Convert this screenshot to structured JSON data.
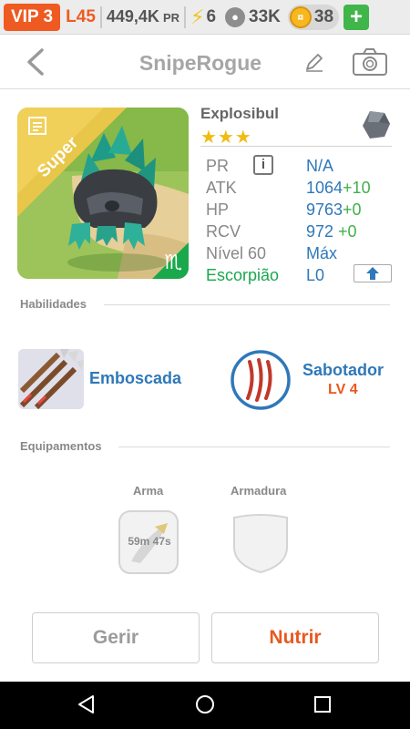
{
  "status": {
    "vip": "VIP 3",
    "level": "L45",
    "power_value": "449,4K",
    "power_unit": "PR",
    "energy": "6",
    "food": "33K",
    "gold": "38",
    "add_label": "+"
  },
  "header": {
    "title": "SnipeRogue"
  },
  "creature": {
    "name": "Explosibul",
    "stars": "★★★",
    "rarity_label": "Super",
    "zodiac_symbol": "♏",
    "stats": [
      {
        "label": "PR",
        "value": "N/A",
        "bonus": ""
      },
      {
        "label": "ATK",
        "value": "1064",
        "bonus": "+10"
      },
      {
        "label": "HP",
        "value": "9763",
        "bonus": "+0"
      },
      {
        "label": "RCV",
        "value": "972",
        "bonus": " +0"
      },
      {
        "label": "Nível 60",
        "value": "Máx",
        "bonus": ""
      },
      {
        "label": "Escorpião",
        "value": "L0",
        "bonus": ""
      }
    ],
    "info_symbol": "i"
  },
  "skills": {
    "section_title": "Habilidades",
    "skill1_name": "Emboscada",
    "skill2_name": "Sabotador",
    "skill2_level": "LV 4"
  },
  "equipment": {
    "section_title": "Equipamentos",
    "weapon_label": "Arma",
    "armor_label": "Armadura",
    "weapon_timer": "59m 47s"
  },
  "actions": {
    "manage_label": "Gerir",
    "feed_label": "Nutrir"
  },
  "colors": {
    "accent_orange": "#ee5a22",
    "stat_blue": "#2f78b9",
    "bonus_green": "#42b04a",
    "star_gold": "#f0bc12"
  },
  "icons": [
    "back-chevron-icon",
    "pencil-icon",
    "camera-icon",
    "info-icon",
    "gem-icon",
    "upgrade-arrow-icon",
    "scorpio-icon",
    "bolt-icon",
    "paw-icon",
    "coin-icon"
  ]
}
